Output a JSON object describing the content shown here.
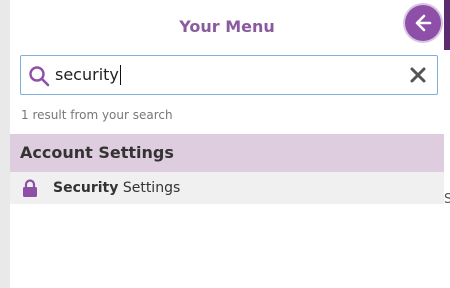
{
  "menu": {
    "title": "Your Menu",
    "back_button_icon": "arrow-left-icon"
  },
  "search": {
    "value": "security",
    "clear_icon": "close-icon",
    "search_icon": "search-icon"
  },
  "results": {
    "count_text": "1 result from your search",
    "sections": [
      {
        "header": "Account Settings",
        "items": [
          {
            "icon": "lock-icon",
            "match": "Security",
            "rest": " Settings"
          }
        ]
      }
    ]
  },
  "background": {
    "edge_char": "S"
  },
  "colors": {
    "accent": "#8e4fa8",
    "title": "#8a5a9e",
    "section_bg": "#decdde",
    "row_bg": "#f0f0f0",
    "input_border": "#7fb0d9"
  }
}
